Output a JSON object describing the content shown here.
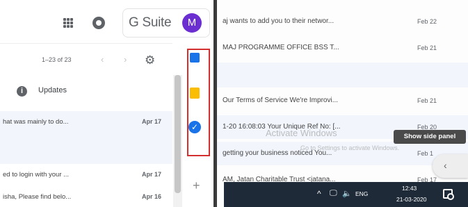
{
  "header": {
    "product_name": "G Suite",
    "avatar_initial": "M",
    "apps_icon": "grid-apps-icon",
    "help_icon": "help-icon"
  },
  "toolbar": {
    "pager_text": "1–23 of 23",
    "prev_glyph": "‹",
    "next_glyph": "›",
    "settings_glyph": "⚙"
  },
  "updates": {
    "label": "Updates",
    "icon_glyph": "i"
  },
  "left_list": {
    "items": [
      {
        "snippet": "hat was mainly to do...",
        "date": "Apr 17"
      },
      {
        "snippet": "ed to login with your ...",
        "date": "Apr 17"
      },
      {
        "snippet": "isha, Please find belo...",
        "date": "Apr 16"
      }
    ]
  },
  "side_panel": {
    "calendar_icon": "calendar-icon",
    "keep_icon": "keep-icon",
    "tasks_icon": "tasks-icon",
    "tasks_glyph": "✓",
    "add_glyph": "+"
  },
  "right_list": {
    "items": [
      {
        "snippet": "aj wants to add you to their networ...",
        "date": "Feb 22"
      },
      {
        "snippet": "MAJ PROGRAMME OFFICE BSS T...",
        "date": "Feb 21"
      },
      {
        "snippet": "Our Terms of Service We're Improvi...",
        "date": "Feb 21"
      },
      {
        "snippet": "1-20 16:08:03 Your Unique Ref No: [...",
        "date": "Feb 20"
      },
      {
        "snippet": "getting your business noticed You...",
        "date": "Feb 1"
      },
      {
        "snippet": "AM, Jatan Charitable Trust <jatana...",
        "date": "Feb 17"
      }
    ]
  },
  "watermark": {
    "title": "Activate Windows",
    "subtitle": "Go to Settings to activate Windows."
  },
  "tooltip": {
    "text": "Show side panel"
  },
  "collapse_tab": {
    "glyph": "‹"
  },
  "taskbar": {
    "chevron_glyph": "^",
    "network_glyph": "🖵",
    "volume_glyph": "🔈",
    "language": "ENG",
    "time": "12:43",
    "date": "21-03-2020"
  }
}
